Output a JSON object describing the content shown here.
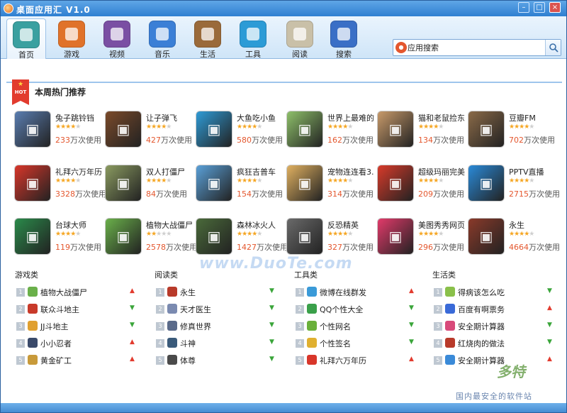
{
  "window": {
    "title": "桌面应用汇 V1.0"
  },
  "colors": {
    "accent": "#2f7fd1",
    "user_count": "#e4572e",
    "trend_up": "#e23b2e",
    "trend_down": "#3aa53a"
  },
  "nav": [
    {
      "label": "首页",
      "icon": "home-icon",
      "color": "#3aa0a0",
      "active": true
    },
    {
      "label": "游戏",
      "icon": "gamepad-icon",
      "color": "#e0722a"
    },
    {
      "label": "视频",
      "icon": "film-icon",
      "color": "#7a4fa3"
    },
    {
      "label": "音乐",
      "icon": "music-note-icon",
      "color": "#3b7fd6"
    },
    {
      "label": "生活",
      "icon": "wallet-icon",
      "color": "#9a6a3a"
    },
    {
      "label": "工具",
      "icon": "monitor-icon",
      "color": "#2c9bd6"
    },
    {
      "label": "阅读",
      "icon": "book-icon",
      "color": "#c9c0a8"
    },
    {
      "label": "搜索",
      "icon": "magnifier-icon",
      "color": "#3a6fc6"
    }
  ],
  "search": {
    "value": "应用搜索",
    "icon": "app-search-icon"
  },
  "section": {
    "title": "本周热门推荐",
    "badge": "HOT"
  },
  "apps": [
    {
      "name": "兔子跳铃铛",
      "rating": 4,
      "users": "233",
      "unit": "万次使用",
      "icon_color": "#5a7db0"
    },
    {
      "name": "让子弹飞",
      "rating": 4,
      "users": "427",
      "unit": "万次使用",
      "icon_color": "#7a4a2a"
    },
    {
      "name": "大鱼吃小鱼",
      "rating": 4,
      "users": "580",
      "unit": "万次使用",
      "icon_color": "#2f9bd6"
    },
    {
      "name": "世界上最难的",
      "rating": 4,
      "users": "162",
      "unit": "万次使用",
      "icon_color": "#8ec06a"
    },
    {
      "name": "猫和老鼠捡东",
      "rating": 4,
      "users": "134",
      "unit": "万次使用",
      "icon_color": "#c89a6a"
    },
    {
      "name": "豆瓣FM",
      "rating": 4,
      "users": "702",
      "unit": "万次使用",
      "icon_color": "#8a6a48"
    },
    {
      "name": "礼拜六万年历",
      "rating": 4,
      "users": "3328",
      "unit": "万次使用",
      "icon_color": "#d8362a"
    },
    {
      "name": "双人打僵尸",
      "rating": 4,
      "users": "84",
      "unit": "万次使用",
      "icon_color": "#8a9a60"
    },
    {
      "name": "疯狂吉普车",
      "rating": 4,
      "users": "154",
      "unit": "万次使用",
      "icon_color": "#5aa0d8"
    },
    {
      "name": "宠物连连看3.",
      "rating": 4,
      "users": "314",
      "unit": "万次使用",
      "icon_color": "#e0b060"
    },
    {
      "name": "超级玛丽完美",
      "rating": 4,
      "users": "209",
      "unit": "万次使用",
      "icon_color": "#d83a2a"
    },
    {
      "name": "PPTV直播",
      "rating": 4,
      "users": "2715",
      "unit": "万次使用",
      "icon_color": "#2a8ad8"
    },
    {
      "name": "台球大师",
      "rating": 4,
      "users": "119",
      "unit": "万次使用",
      "icon_color": "#2a8a4a"
    },
    {
      "name": "植物大战僵尸",
      "rating": 2,
      "users": "2578",
      "unit": "万次使用",
      "icon_color": "#6ab04a"
    },
    {
      "name": "森林冰火人",
      "rating": 4,
      "users": "1427",
      "unit": "万次使用",
      "icon_color": "#4a6a3a"
    },
    {
      "name": "反恐精英",
      "rating": 4,
      "users": "327",
      "unit": "万次使用",
      "icon_color": "#6a6a6a"
    },
    {
      "name": "美图秀秀网页",
      "rating": 4,
      "users": "296",
      "unit": "万次使用",
      "icon_color": "#e23a6a"
    },
    {
      "name": "永生",
      "rating": 4,
      "users": "4664",
      "unit": "万次使用",
      "icon_color": "#8a3a2a"
    }
  ],
  "categories": [
    {
      "title": "游戏类",
      "items": [
        {
          "rank": "1",
          "name": "植物大战僵尸",
          "trend": "up",
          "icon_color": "#6ab04a"
        },
        {
          "rank": "2",
          "name": "联众斗地主",
          "trend": "down",
          "icon_color": "#c83a2a"
        },
        {
          "rank": "3",
          "name": "JJ斗地主",
          "trend": "down",
          "icon_color": "#e0a030"
        },
        {
          "rank": "4",
          "name": "小小忍者",
          "trend": "up",
          "icon_color": "#3a4a6a"
        },
        {
          "rank": "5",
          "name": "黄金矿工",
          "trend": "up",
          "icon_color": "#c89a3a"
        }
      ]
    },
    {
      "title": "阅读类",
      "items": [
        {
          "rank": "1",
          "name": "永生",
          "trend": "down",
          "icon_color": "#b83a2a"
        },
        {
          "rank": "2",
          "name": "天才医生",
          "trend": "down",
          "icon_color": "#7a8ab0"
        },
        {
          "rank": "3",
          "name": "修真世界",
          "trend": "down",
          "icon_color": "#5a6a8a"
        },
        {
          "rank": "4",
          "name": "斗神",
          "trend": "down",
          "icon_color": "#3a5a7a"
        },
        {
          "rank": "5",
          "name": "体尊",
          "trend": "down",
          "icon_color": "#4a4a4a"
        }
      ]
    },
    {
      "title": "工具类",
      "items": [
        {
          "rank": "1",
          "name": "微博在线群发",
          "trend": "up",
          "icon_color": "#3a9ad8"
        },
        {
          "rank": "2",
          "name": "QQ个性大全",
          "trend": "down",
          "icon_color": "#3aa04a"
        },
        {
          "rank": "3",
          "name": "个性网名",
          "trend": "down",
          "icon_color": "#6ab03a"
        },
        {
          "rank": "4",
          "name": "个性签名",
          "trend": "down",
          "icon_color": "#e0b030"
        },
        {
          "rank": "5",
          "name": "礼拜六万年历",
          "trend": "up",
          "icon_color": "#d8362a"
        }
      ]
    },
    {
      "title": "生活类",
      "items": [
        {
          "rank": "1",
          "name": "得病该怎么吃",
          "trend": "down",
          "icon_color": "#8ac04a"
        },
        {
          "rank": "2",
          "name": "百度有啊票务",
          "trend": "up",
          "icon_color": "#3a6ad8"
        },
        {
          "rank": "3",
          "name": "安全期计算器",
          "trend": "down",
          "icon_color": "#d84a7a"
        },
        {
          "rank": "4",
          "name": "红烧肉的做法",
          "trend": "down",
          "icon_color": "#b83a2a"
        },
        {
          "rank": "5",
          "name": "安全期计算器",
          "trend": "up",
          "icon_color": "#3a8ad8"
        }
      ]
    }
  ],
  "watermark": {
    "mid": "www.DuoTe.com",
    "brand": "多特",
    "sub": "国内最安全的软件站"
  }
}
